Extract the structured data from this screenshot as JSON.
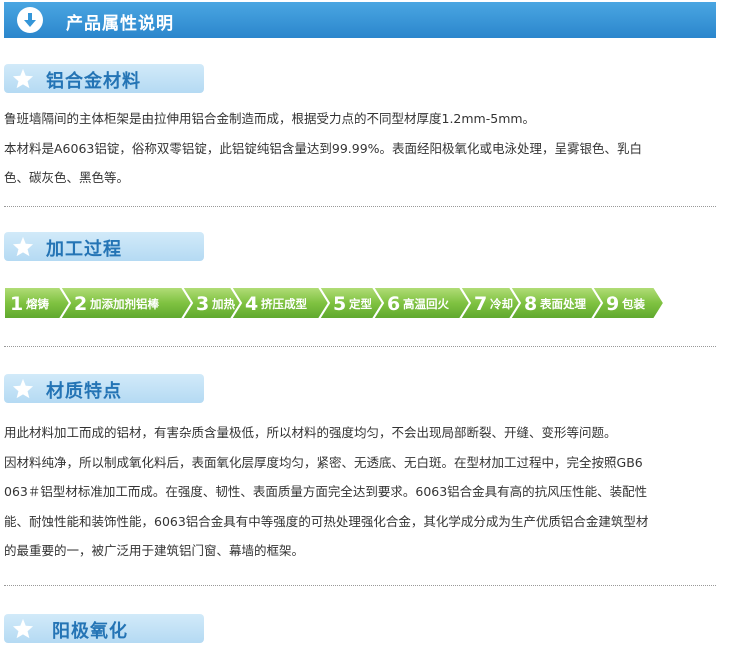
{
  "header": {
    "title": "产品属性说明",
    "icon": "arrow-down-icon"
  },
  "sections": {
    "material": {
      "title": "铝合金材料",
      "lines": [
        "鲁班墙隔间的主体柜架是由拉伸用铝合金制造而成，根据受力点的不同型材厚度1.2mm-5mm。",
        "本材料是A6063铝锭，俗称双零铝锭，此铝锭纯铝含量达到99.99%。表面经阳极氧化或电泳处理，呈雾银色、乳白",
        "色、碳灰色、黑色等。"
      ]
    },
    "process": {
      "title": "加工过程",
      "steps": [
        {
          "num": "1",
          "label": "熔铸"
        },
        {
          "num": "2",
          "label": "加添加剂铝棒"
        },
        {
          "num": "3",
          "label": "加热"
        },
        {
          "num": "4",
          "label": "挤压成型"
        },
        {
          "num": "5",
          "label": "定型"
        },
        {
          "num": "6",
          "label": "高温回火"
        },
        {
          "num": "7",
          "label": "冷却"
        },
        {
          "num": "8",
          "label": "表面处理"
        },
        {
          "num": "9",
          "label": "包装"
        }
      ]
    },
    "quality": {
      "title": "材质特点",
      "lines": [
        "用此材料加工而成的铝材，有害杂质含量极低，所以材料的强度均匀，不会出现局部断裂、开缝、变形等问题。",
        "因材料纯净，所以制成氧化料后，表面氧化层厚度均匀，紧密、无透底、无白斑。在型材加工过程中，完全按照GB6",
        "063＃铝型材标准加工而成。在强度、韧性、表面质量方面完全达到要求。6063铝合金具有高的抗风压性能、装配性",
        "能、耐蚀性能和装饰性能，6063铝合金具有中等强度的可热处理强化合金，其化学成分成为生产优质铝合金建筑型材",
        "的最重要的一，被广泛用于建筑铝门窗、幕墙的框架。"
      ]
    },
    "anodize": {
      "title": "阳极氧化"
    }
  },
  "colors": {
    "banner": "#3496d8",
    "tab": "#c4e3f7",
    "tab_text": "#2474b5",
    "step_green": "#7fc241",
    "step_text": "#ffffff"
  }
}
